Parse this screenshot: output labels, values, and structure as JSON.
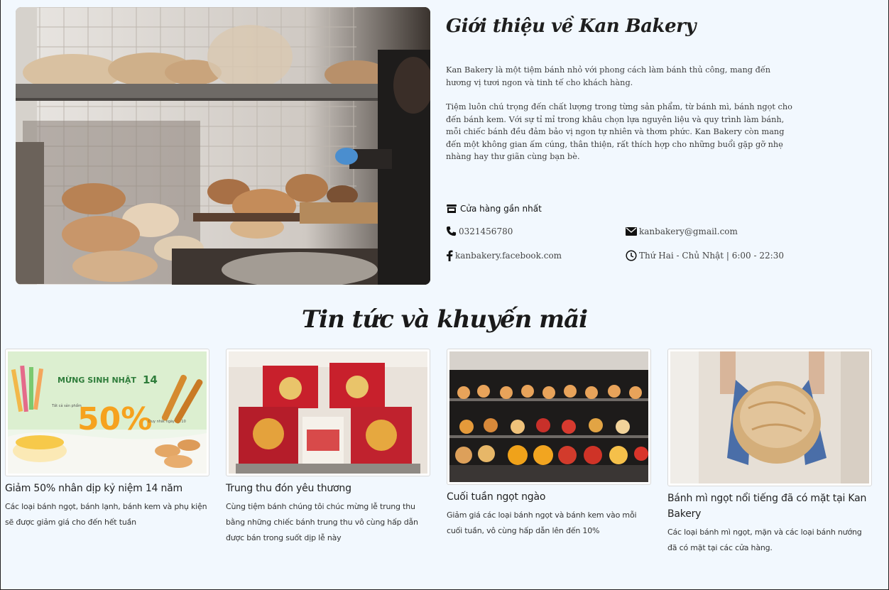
{
  "about": {
    "title": "Giới thiệu về Kan Bakery",
    "paragraph1": "Kan Bakery là một tiệm bánh nhỏ với phong cách làm bánh thủ công, mang đến hương vị tươi ngon và tinh tế cho khách hàng.",
    "paragraph2": "Tiệm luôn chú trọng đến chất lượng trong từng sản phẩm, từ bánh mì, bánh ngọt cho đến bánh kem. Với sự tỉ mỉ trong khâu chọn lựa nguyên liệu và quy trình làm bánh, mỗi chiếc bánh đều đảm bảo vị ngon tự nhiên và thơm phức. Kan Bakery còn mang đến một không gian ấm cúng, thân thiện, rất thích hợp cho những buổi gặp gỡ nhẹ nhàng hay thư giãn cùng bạn bè.",
    "store_heading": "Cửa hàng gần nhất",
    "phone": "0321456780",
    "email": "kanbakery@gmail.com",
    "facebook": "kanbakery.facebook.com",
    "hours": "Thứ Hai - Chủ Nhật | 6:00 - 22:30"
  },
  "news": {
    "title": "Tin tức và khuyến mãi",
    "items": [
      {
        "title": "Giảm 50% nhân dịp kỷ niệm 14 năm",
        "description": "Các loại bánh ngọt, bánh lạnh, bánh kem và phụ kiện sẽ được giảm giá cho đến hết tuần",
        "banner_heading": "MỪNG SINH NHẬT",
        "banner_number": "14",
        "banner_percent": "50%",
        "banner_small_left": "Tất cả sản phẩm",
        "banner_small_right": "Duy nhất ngày 10.10"
      },
      {
        "title": "Trung thu đón yêu thương",
        "description": "Cùng tiệm bánh chúng tôi chúc mừng lễ trung thu bằng những chiếc bánh trung thu vô cùng hấp dẫn được bán trong suốt dịp lễ này"
      },
      {
        "title": "Cuối tuần ngọt ngào",
        "description": "Giảm giá các loại bánh ngọt và bánh kem vào mỗi cuối tuần, vô cùng hấp dẫn lên đến 10%"
      },
      {
        "title": "Bánh mì ngọt nổi tiếng đã có mặt tại Kan Bakery",
        "description": "Các loại bánh mì ngọt, mặn và các loại bánh nướng đã có mặt tại các cửa hàng."
      }
    ]
  },
  "icons": {
    "store": "store-icon",
    "phone": "phone-icon",
    "email": "envelope-icon",
    "facebook": "facebook-icon",
    "clock": "clock-icon"
  },
  "colors": {
    "page_background": "#f2f8fe",
    "banner_green": "#dcefd0",
    "banner_orange": "#f6a21e",
    "mooncake_red": "#c8202c"
  }
}
